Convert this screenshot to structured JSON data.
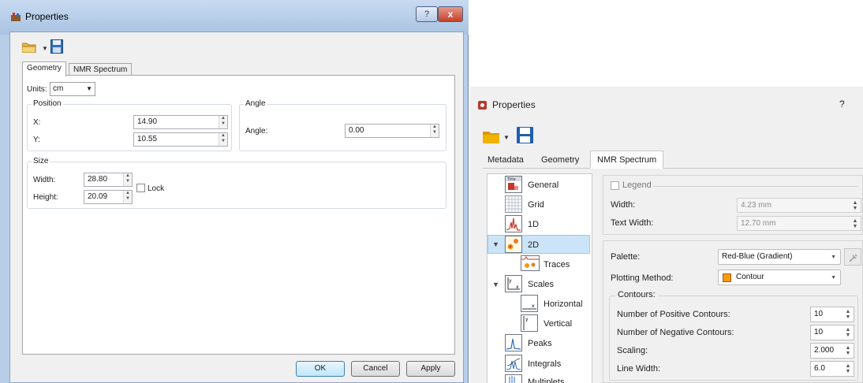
{
  "left_dialog": {
    "title": "Properties",
    "help_glyph": "?",
    "close_glyph": "x",
    "tabs": [
      "Geometry",
      "NMR Spectrum"
    ],
    "units_label": "Units:",
    "units_value": "cm",
    "position": {
      "title": "Position",
      "x_label": "X:",
      "x_value": "14.90",
      "y_label": "Y:",
      "y_value": "10.55"
    },
    "angle": {
      "title": "Angle",
      "angle_label": "Angle:",
      "angle_value": "0.00"
    },
    "size": {
      "title": "Size",
      "width_label": "Width:",
      "width_value": "28.80",
      "height_label": "Height:",
      "height_value": "20.09",
      "lock_label": "Lock"
    },
    "buttons": {
      "ok": "OK",
      "cancel": "Cancel",
      "apply": "Apply"
    },
    "colors": {
      "title_gradient_top": "#c8daf0",
      "close_red": "#c4402a"
    }
  },
  "right_dialog": {
    "title": "Properties",
    "help_glyph": "?",
    "tabs": [
      "Metadata",
      "Geometry",
      "NMR Spectrum"
    ],
    "tree": [
      {
        "label": "General",
        "icon": "title-icon"
      },
      {
        "label": "Grid",
        "icon": "grid-icon"
      },
      {
        "label": "1D",
        "icon": "spectrum-1d-icon"
      },
      {
        "label": "2D",
        "icon": "spectrum-2d-icon",
        "selected": true
      },
      {
        "label": "Traces",
        "icon": "traces-icon"
      },
      {
        "label": "Scales",
        "icon": "scales-icon"
      },
      {
        "label": "Horizontal",
        "icon": "horizontal-scale-icon"
      },
      {
        "label": "Vertical",
        "icon": "vertical-scale-icon"
      },
      {
        "label": "Peaks",
        "icon": "peaks-icon"
      },
      {
        "label": "Integrals",
        "icon": "integrals-icon"
      },
      {
        "label": "Multiplets",
        "icon": "multiplets-icon"
      }
    ],
    "legend": {
      "checkbox_label": "Legend",
      "width_label": "Width:",
      "width_value": "4.23 mm",
      "text_width_label": "Text Width:",
      "text_width_value": "12.70 mm"
    },
    "palette": {
      "label": "Palette:",
      "value": "Red-Blue (Gradient)"
    },
    "plotting": {
      "label": "Plotting Method:",
      "value": "Contour"
    },
    "contours": {
      "title": "Contours:",
      "positive_label": "Number of Positive Contours:",
      "positive_value": "10",
      "negative_label": "Number of Negative Contours:",
      "negative_value": "10",
      "scaling_label": "Scaling:",
      "scaling_value": "2.000",
      "line_width_label": "Line Width:",
      "line_width_value": "6.0"
    },
    "colors": {
      "selection_bg": "#cce4f7",
      "folder_yellow": "#f2b300",
      "save_blue": "#1f5fae"
    }
  }
}
